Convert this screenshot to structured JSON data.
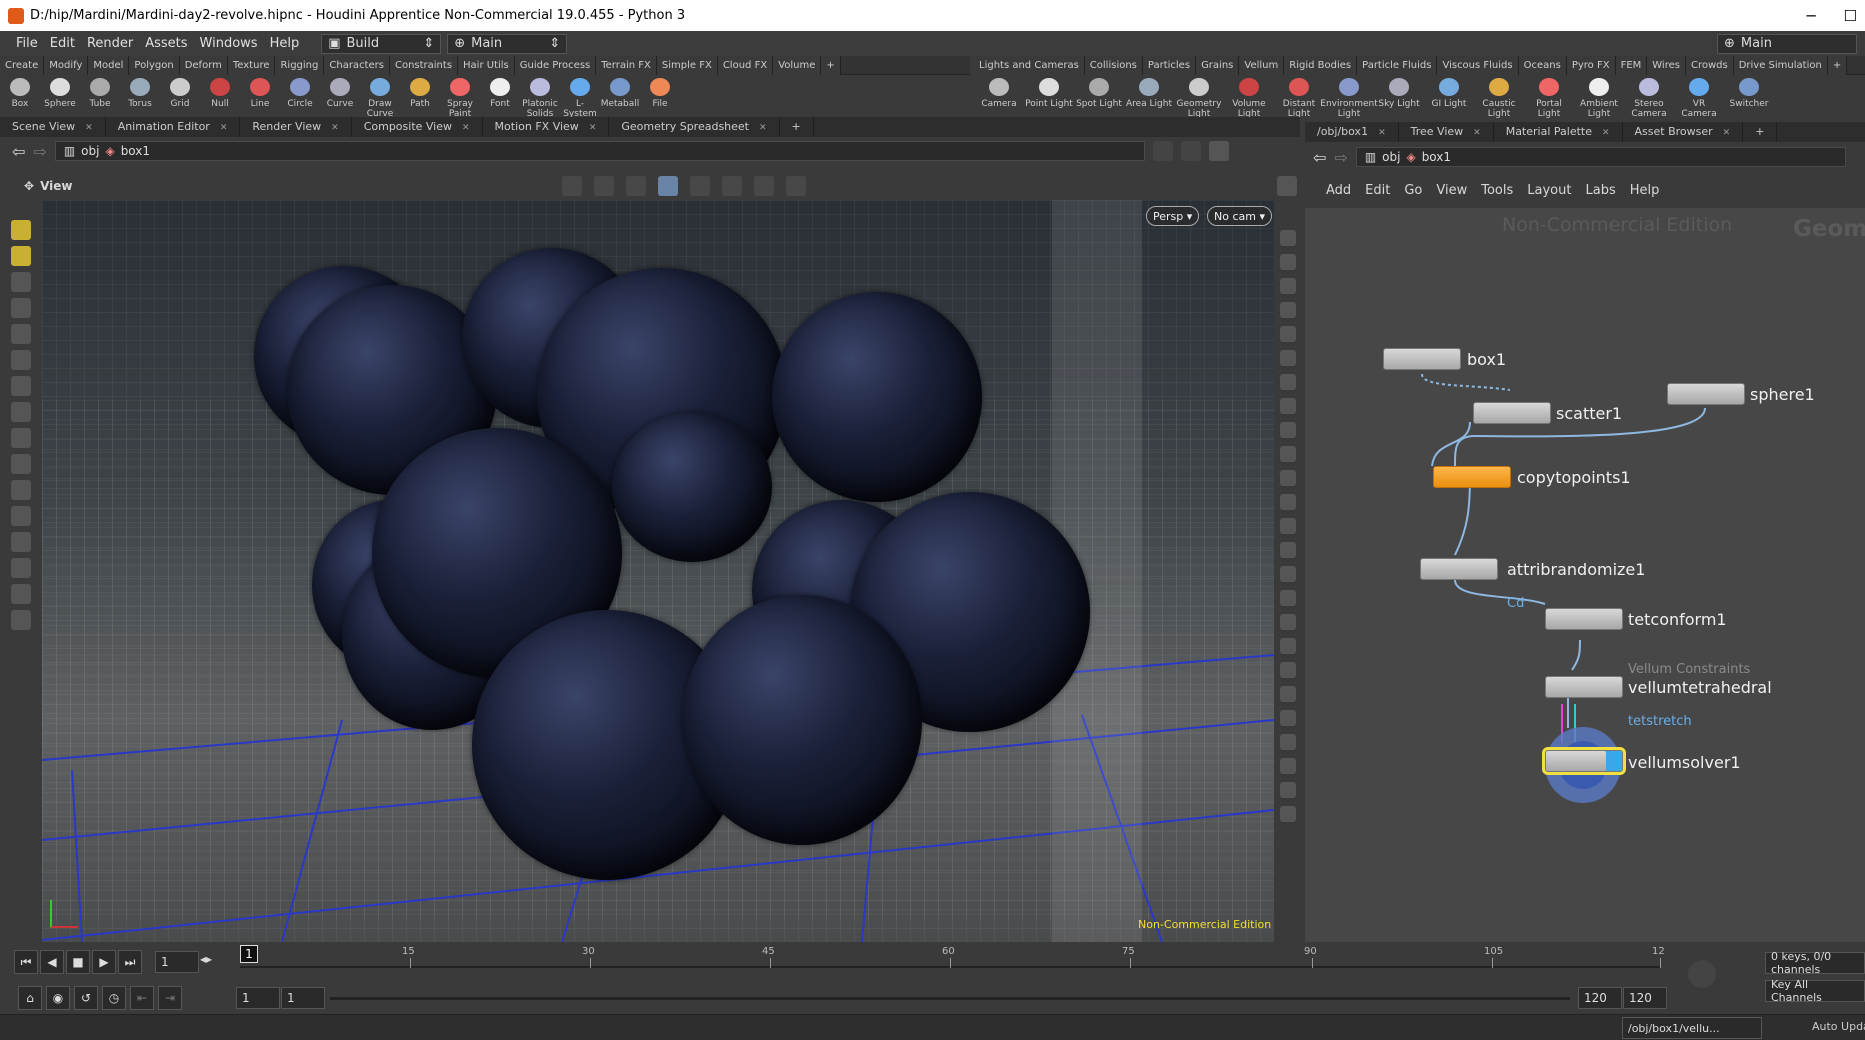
{
  "title": "D:/hip/Mardini/Mardini-day2-revolve.hipnc - Houdini Apprentice Non-Commercial 19.0.455 - Python 3",
  "window_controls": {
    "minimize": "─",
    "maximize": "☐"
  },
  "menu": [
    "File",
    "Edit",
    "Render",
    "Assets",
    "Windows",
    "Help"
  ],
  "desktop_combo": "Build",
  "main_combo": "Main",
  "right_main_label": "Main",
  "shelf_left_tabs": [
    "Create",
    "Modify",
    "Model",
    "Polygon",
    "Deform",
    "Texture",
    "Rigging",
    "Characters",
    "Constraints",
    "Hair Utils",
    "Guide Process",
    "Terrain FX",
    "Simple FX",
    "Cloud FX",
    "Volume",
    "+"
  ],
  "shelf_left_tools": [
    "Box",
    "Sphere",
    "Tube",
    "Torus",
    "Grid",
    "Null",
    "Line",
    "Circle",
    "Curve",
    "Draw Curve",
    "Path",
    "Spray Paint",
    "Font",
    "Platonic Solids",
    "L-System",
    "Metaball",
    "File"
  ],
  "shelf_right_tabs": [
    "Lights and Cameras",
    "Collisions",
    "Particles",
    "Grains",
    "Vellum",
    "Rigid Bodies",
    "Particle Fluids",
    "Viscous Fluids",
    "Oceans",
    "Pyro FX",
    "FEM",
    "Wires",
    "Crowds",
    "Drive Simulation",
    "+"
  ],
  "shelf_right_tools": [
    "Camera",
    "Point Light",
    "Spot Light",
    "Area Light",
    "Geometry Light",
    "Volume Light",
    "Distant Light",
    "Environment Light",
    "Sky Light",
    "GI Light",
    "Caustic Light",
    "Portal Light",
    "Ambient Light",
    "Stereo Camera",
    "VR Camera",
    "Switcher"
  ],
  "left_pane_tabs": [
    "Scene View",
    "Animation Editor",
    "Render View",
    "Composite View",
    "Motion FX View",
    "Geometry Spreadsheet",
    "+"
  ],
  "right_pane_tabs": [
    "/obj/box1",
    "Tree View",
    "Material Palette",
    "Asset Browser",
    "+"
  ],
  "left_path": {
    "root": "obj",
    "node": "box1"
  },
  "right_path": {
    "root": "obj",
    "node": "box1"
  },
  "viewer": {
    "label": "View",
    "persp_label": "Persp ▾",
    "cam_label": "No cam ▾",
    "watermark": "Non-Commercial Edition"
  },
  "network": {
    "menu": [
      "Add",
      "Edit",
      "Go",
      "View",
      "Tools",
      "Layout",
      "Labs",
      "Help"
    ],
    "watermark": "Non-Commercial Edition",
    "context_label": "Geome",
    "nodes": [
      {
        "name": "box1"
      },
      {
        "name": "scatter1"
      },
      {
        "name": "sphere1"
      },
      {
        "name": "copytopoints1"
      },
      {
        "name": "attribrandomize1",
        "flag": "Cd"
      },
      {
        "name": "tetconform1"
      },
      {
        "name": "vellumtetrahedral",
        "sublabel": "Vellum Constraints",
        "flag": "tetstretch"
      },
      {
        "name": "vellumsolver1"
      }
    ]
  },
  "timeline": {
    "current_frame": "1",
    "frame_marker": "1",
    "ticks": [
      "15",
      "30",
      "45",
      "60",
      "75",
      "90",
      "105",
      "12"
    ],
    "range_start_a": "1",
    "range_start_b": "1",
    "range_end_a": "120",
    "range_end_b": "120",
    "keys_info": "0 keys, 0/0 channels",
    "key_all_channels": "Key All Channels",
    "auto_update": "Auto Update",
    "status_path": "/obj/box1/vellu..."
  },
  "colors": {
    "accent_orange": "#f5a623",
    "display_flag_blue": "#3aa8e8",
    "selected_node": "#f0e040",
    "wire": "#8fb8e0"
  }
}
